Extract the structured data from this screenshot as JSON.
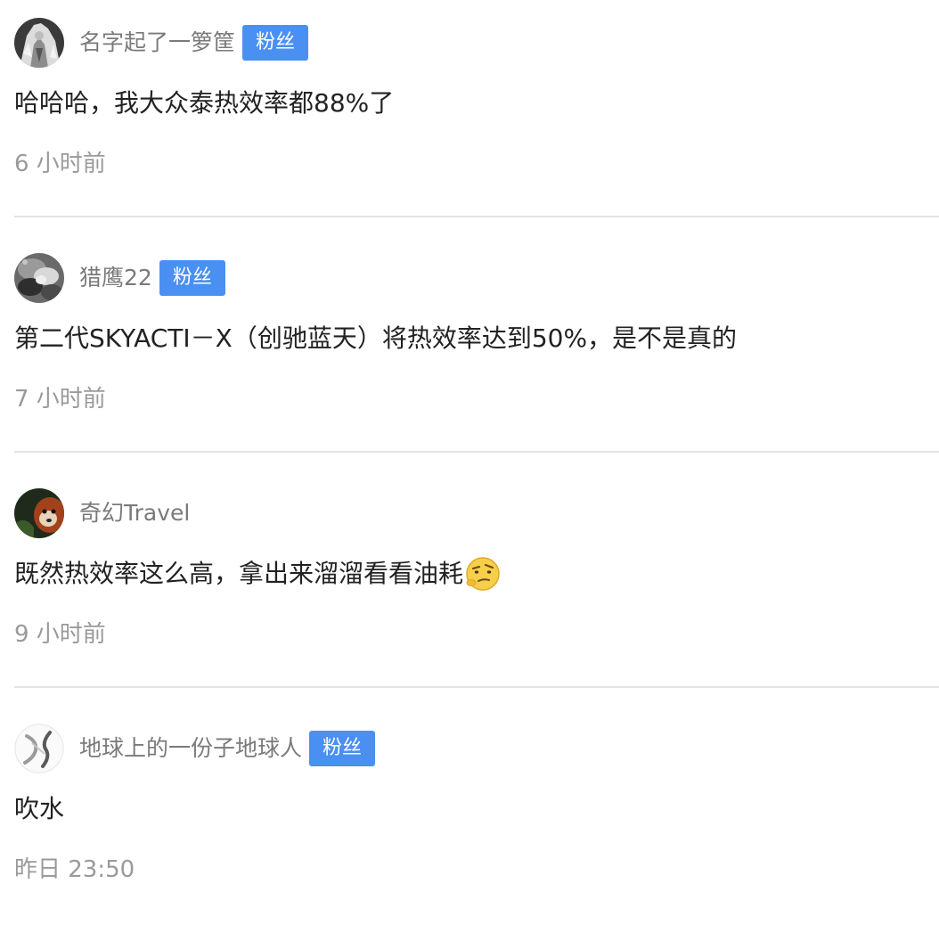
{
  "comments": [
    {
      "avatar_icon": "anime-character-avatar-icon",
      "username": "名字起了一箩筐",
      "badge": "粉丝",
      "content": "哈哈哈，我大众泰热效率都88%了",
      "time": "6 小时前"
    },
    {
      "avatar_icon": "grey-texture-avatar-icon",
      "username": "猎鹰22",
      "badge": "粉丝",
      "content": "第二代SKYACTI－X（创驰蓝天）将热效率达到50%，是不是真的",
      "time": "7 小时前"
    },
    {
      "avatar_icon": "red-panda-avatar-icon",
      "username": "奇幻Travel",
      "badge": "",
      "content": "既然热效率这么高，拿出来溜溜看看油耗",
      "emoji": "doubt-face-emoji-icon",
      "time": "9 小时前"
    },
    {
      "avatar_icon": "ds-logo-avatar-icon",
      "username": "地球上的一份子地球人",
      "badge": "粉丝",
      "content": "吹水",
      "time": "昨日 23:50"
    }
  ],
  "colors": {
    "badge_bg": "#4a90f2",
    "username": "#7a7a7a",
    "content": "#222222",
    "time": "#9a9a9a",
    "divider": "#e3e3e3"
  }
}
